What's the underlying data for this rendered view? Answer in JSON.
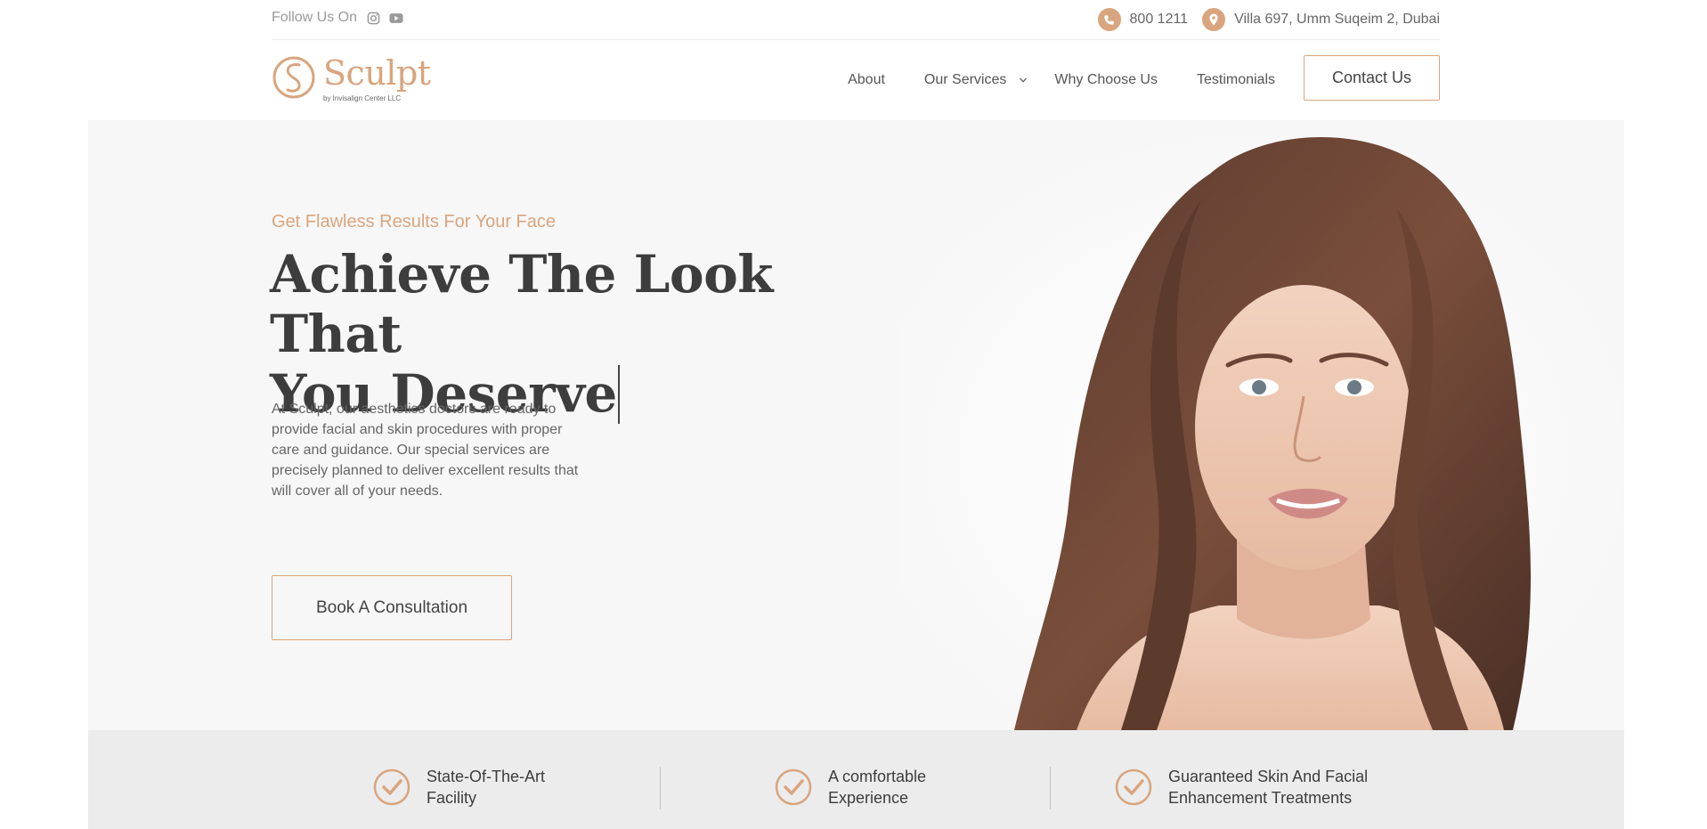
{
  "topbar": {
    "follow_label": "Follow Us On",
    "social_icons": [
      "instagram-icon",
      "youtube-icon"
    ],
    "phone": "800 1211",
    "address": "Villa 697, Umm Suqeim 2, Dubai"
  },
  "header": {
    "logo_name": "Sculpt",
    "logo_sub": "by Invisalign Center LLC",
    "nav": [
      {
        "label": "About"
      },
      {
        "label": "Our Services",
        "has_dropdown": true
      },
      {
        "label": "Why Choose Us"
      },
      {
        "label": "Testimonials"
      }
    ],
    "contact_button": "Contact Us"
  },
  "hero": {
    "eyebrow": "Get Flawless Results For Your Face",
    "headline_line1": "Achieve The Look That",
    "headline_line2": "You Deserve",
    "description": "At Sculpt, our aesthetics doctors are ready to provide facial and skin procedures with proper care and guidance. Our special services are precisely planned to deliver excellent results that will cover all of your needs.",
    "cta": "Book A Consultation"
  },
  "features": [
    {
      "line1": "State-Of-The-Art",
      "line2": "Facility"
    },
    {
      "line1": "A comfortable",
      "line2": "Experience"
    },
    {
      "line1": "Guaranteed Skin And Facial",
      "line2": "Enhancement Treatments"
    }
  ],
  "colors": {
    "accent": "#d9a57e",
    "hero_bg": "#f7f7f7",
    "features_bg": "#ececec",
    "text_dark": "#3d3d3d"
  }
}
